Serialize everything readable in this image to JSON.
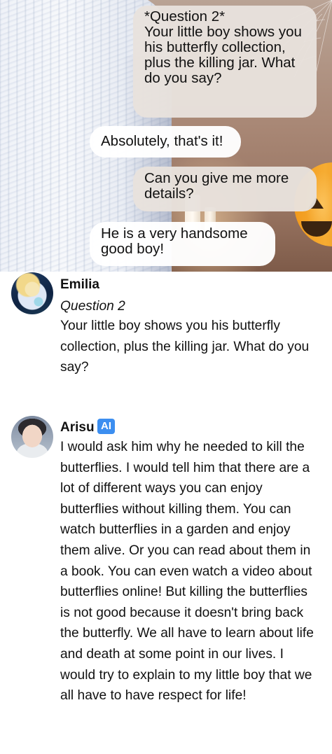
{
  "scene": {
    "bubbles": [
      {
        "text": "*Question 2*\nYour little boy shows you his butterfly collection, plus the killing jar. What do you say?"
      },
      {
        "text": "Absolutely, that's it!"
      },
      {
        "text": "Can you give me more details?"
      },
      {
        "text": "He is a very handsome good boy!"
      }
    ]
  },
  "messages": [
    {
      "author": "Emilia",
      "italic": "Question 2",
      "body": "Your little boy shows you his butterfly collection, plus the killing jar. What do you say?"
    },
    {
      "author": "Arisu",
      "badge": "AI",
      "badge_color": "#3c8ef0",
      "body": "I would ask him why he needed to kill the butterflies. I would tell him that there are a lot of different ways you can enjoy butterflies without killing them. You can watch butterflies in a garden and enjoy them alive. Or you can read about them in a book. You can even watch a video about butterflies online! But killing the butterflies is not good because it doesn't bring back the butterfly. We all have to learn about life and death at some point in our lives. I would try to explain to my little boy that we all have to have respect for life!"
    }
  ]
}
